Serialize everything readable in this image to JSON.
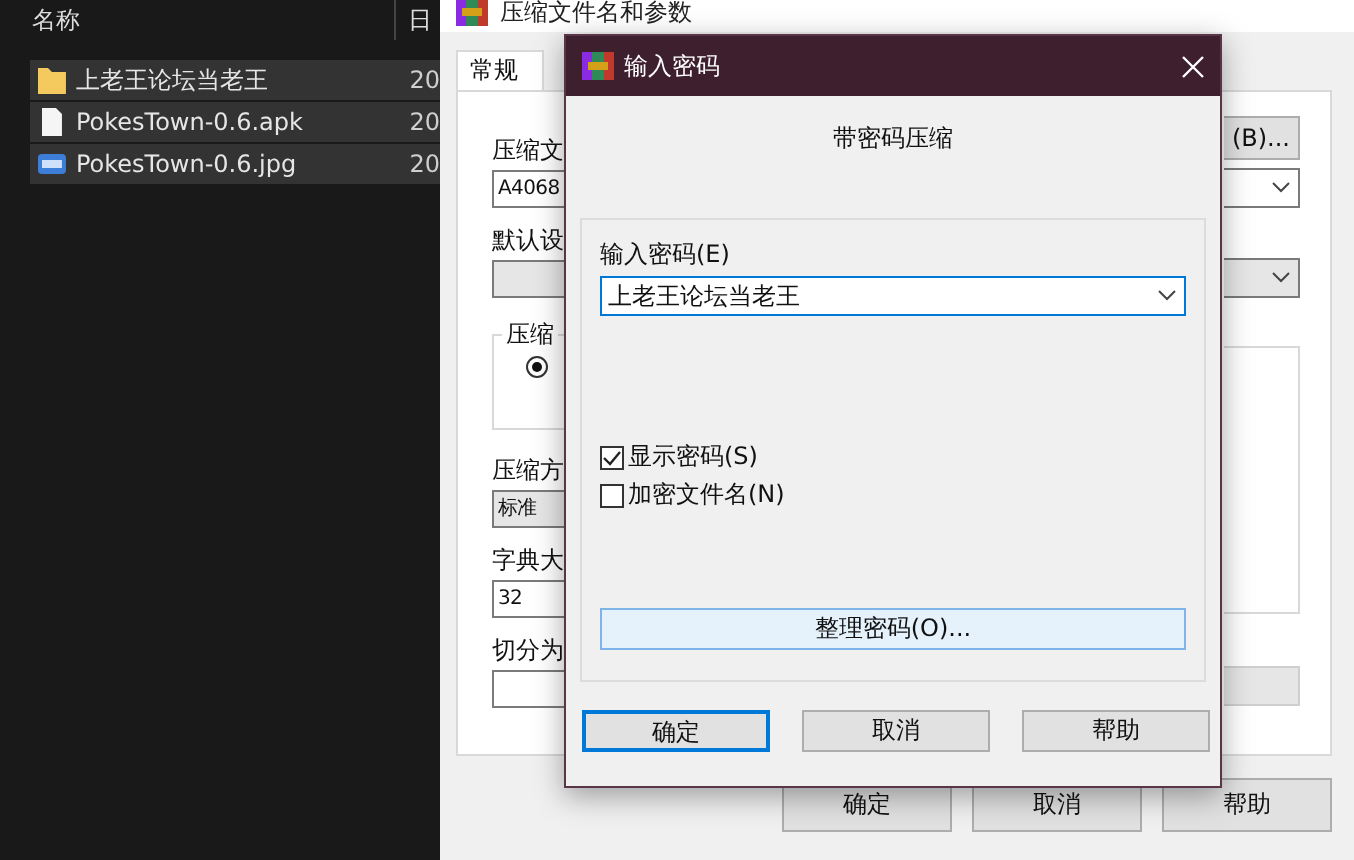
{
  "explorer": {
    "columns": [
      "名称",
      "日"
    ],
    "rows": [
      {
        "kind": "folder",
        "name": "上老王论坛当老王",
        "date": "20",
        "selected": true
      },
      {
        "kind": "file",
        "name": "PokesTown-0.6.apk",
        "date": "20",
        "selected": true
      },
      {
        "kind": "image",
        "name": "PokesTown-0.6.jpg",
        "date": "20",
        "selected": true
      }
    ]
  },
  "archive_dialog": {
    "title": "压缩文件名和参数",
    "tabs": [
      {
        "label": "常规",
        "selected": true
      }
    ],
    "left_items": [
      {
        "kind": "label",
        "text": "压缩文"
      },
      {
        "kind": "input",
        "value": "A4068"
      },
      {
        "kind": "label",
        "text": "默认设"
      },
      {
        "kind": "select"
      },
      {
        "kind": "group",
        "legend": "压缩",
        "radio_selected": true
      },
      {
        "kind": "label",
        "text": "压缩方"
      },
      {
        "kind": "select",
        "value": "标准"
      },
      {
        "kind": "label",
        "text": "字典大"
      },
      {
        "kind": "input",
        "value": "32"
      },
      {
        "kind": "label",
        "text": "切分为"
      },
      {
        "kind": "input"
      }
    ],
    "browse_button": "(B)...",
    "buttons": [
      "确定",
      "取消",
      "帮助"
    ]
  },
  "password_dialog": {
    "title": "输入密码",
    "heading": "带密码压缩",
    "password_label": "输入密码(E)",
    "password_value": "上老王论坛当老王",
    "checkboxes": [
      {
        "label": "显示密码(S)",
        "checked": true
      },
      {
        "label": "加密文件名(N)",
        "checked": false
      }
    ],
    "manage_button": "整理密码(O)...",
    "buttons": [
      {
        "label": "确定",
        "default": true
      },
      {
        "label": "取消",
        "default": false
      },
      {
        "label": "帮助",
        "default": false
      }
    ]
  }
}
